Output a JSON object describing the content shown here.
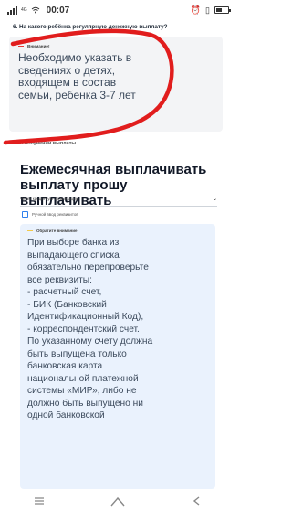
{
  "status_bar": {
    "network_label": "4G",
    "time": "00:07",
    "icons": [
      "signal-icon",
      "wifi-icon",
      "alarm-icon",
      "battery-icon"
    ]
  },
  "question": {
    "text": "6. На какого ребёнка регулярную денежную выплату?"
  },
  "warning": {
    "label": "Внимание!",
    "text": "Необходимо указать в сведениях о детях, входящем в состав семьи, ребенка 3-7 лет",
    "accent_color": "#e53935"
  },
  "section": {
    "label": "...об получении выплаты"
  },
  "payment": {
    "title": "Ежемесячная выплачивать выплату прошу выплачивать",
    "select_placeholder": "Через кредитную организацию",
    "checkbox_label": "Ручной ввод реквизитов",
    "checkbox_checked": false
  },
  "info": {
    "label": "Обратите внимание",
    "paragraphs": [
      "При выборе банка из выпадающего списка обязательно перепроверьте все реквизиты:",
      "- расчетный счет,",
      "- БИК (Банковский Идентификационный Код),",
      "- корреспондентский счет.",
      "По указанному счету должна быть выпущена только банковская карта национальной платежной системы «МИР», либо не должно быть выпущено ни одной банковской"
    ],
    "accent_color": "#f2c94c"
  },
  "colors": {
    "scribble": "#e11d1d",
    "info_background": "#eaf2fd",
    "warning_background": "#f3f4f6"
  }
}
